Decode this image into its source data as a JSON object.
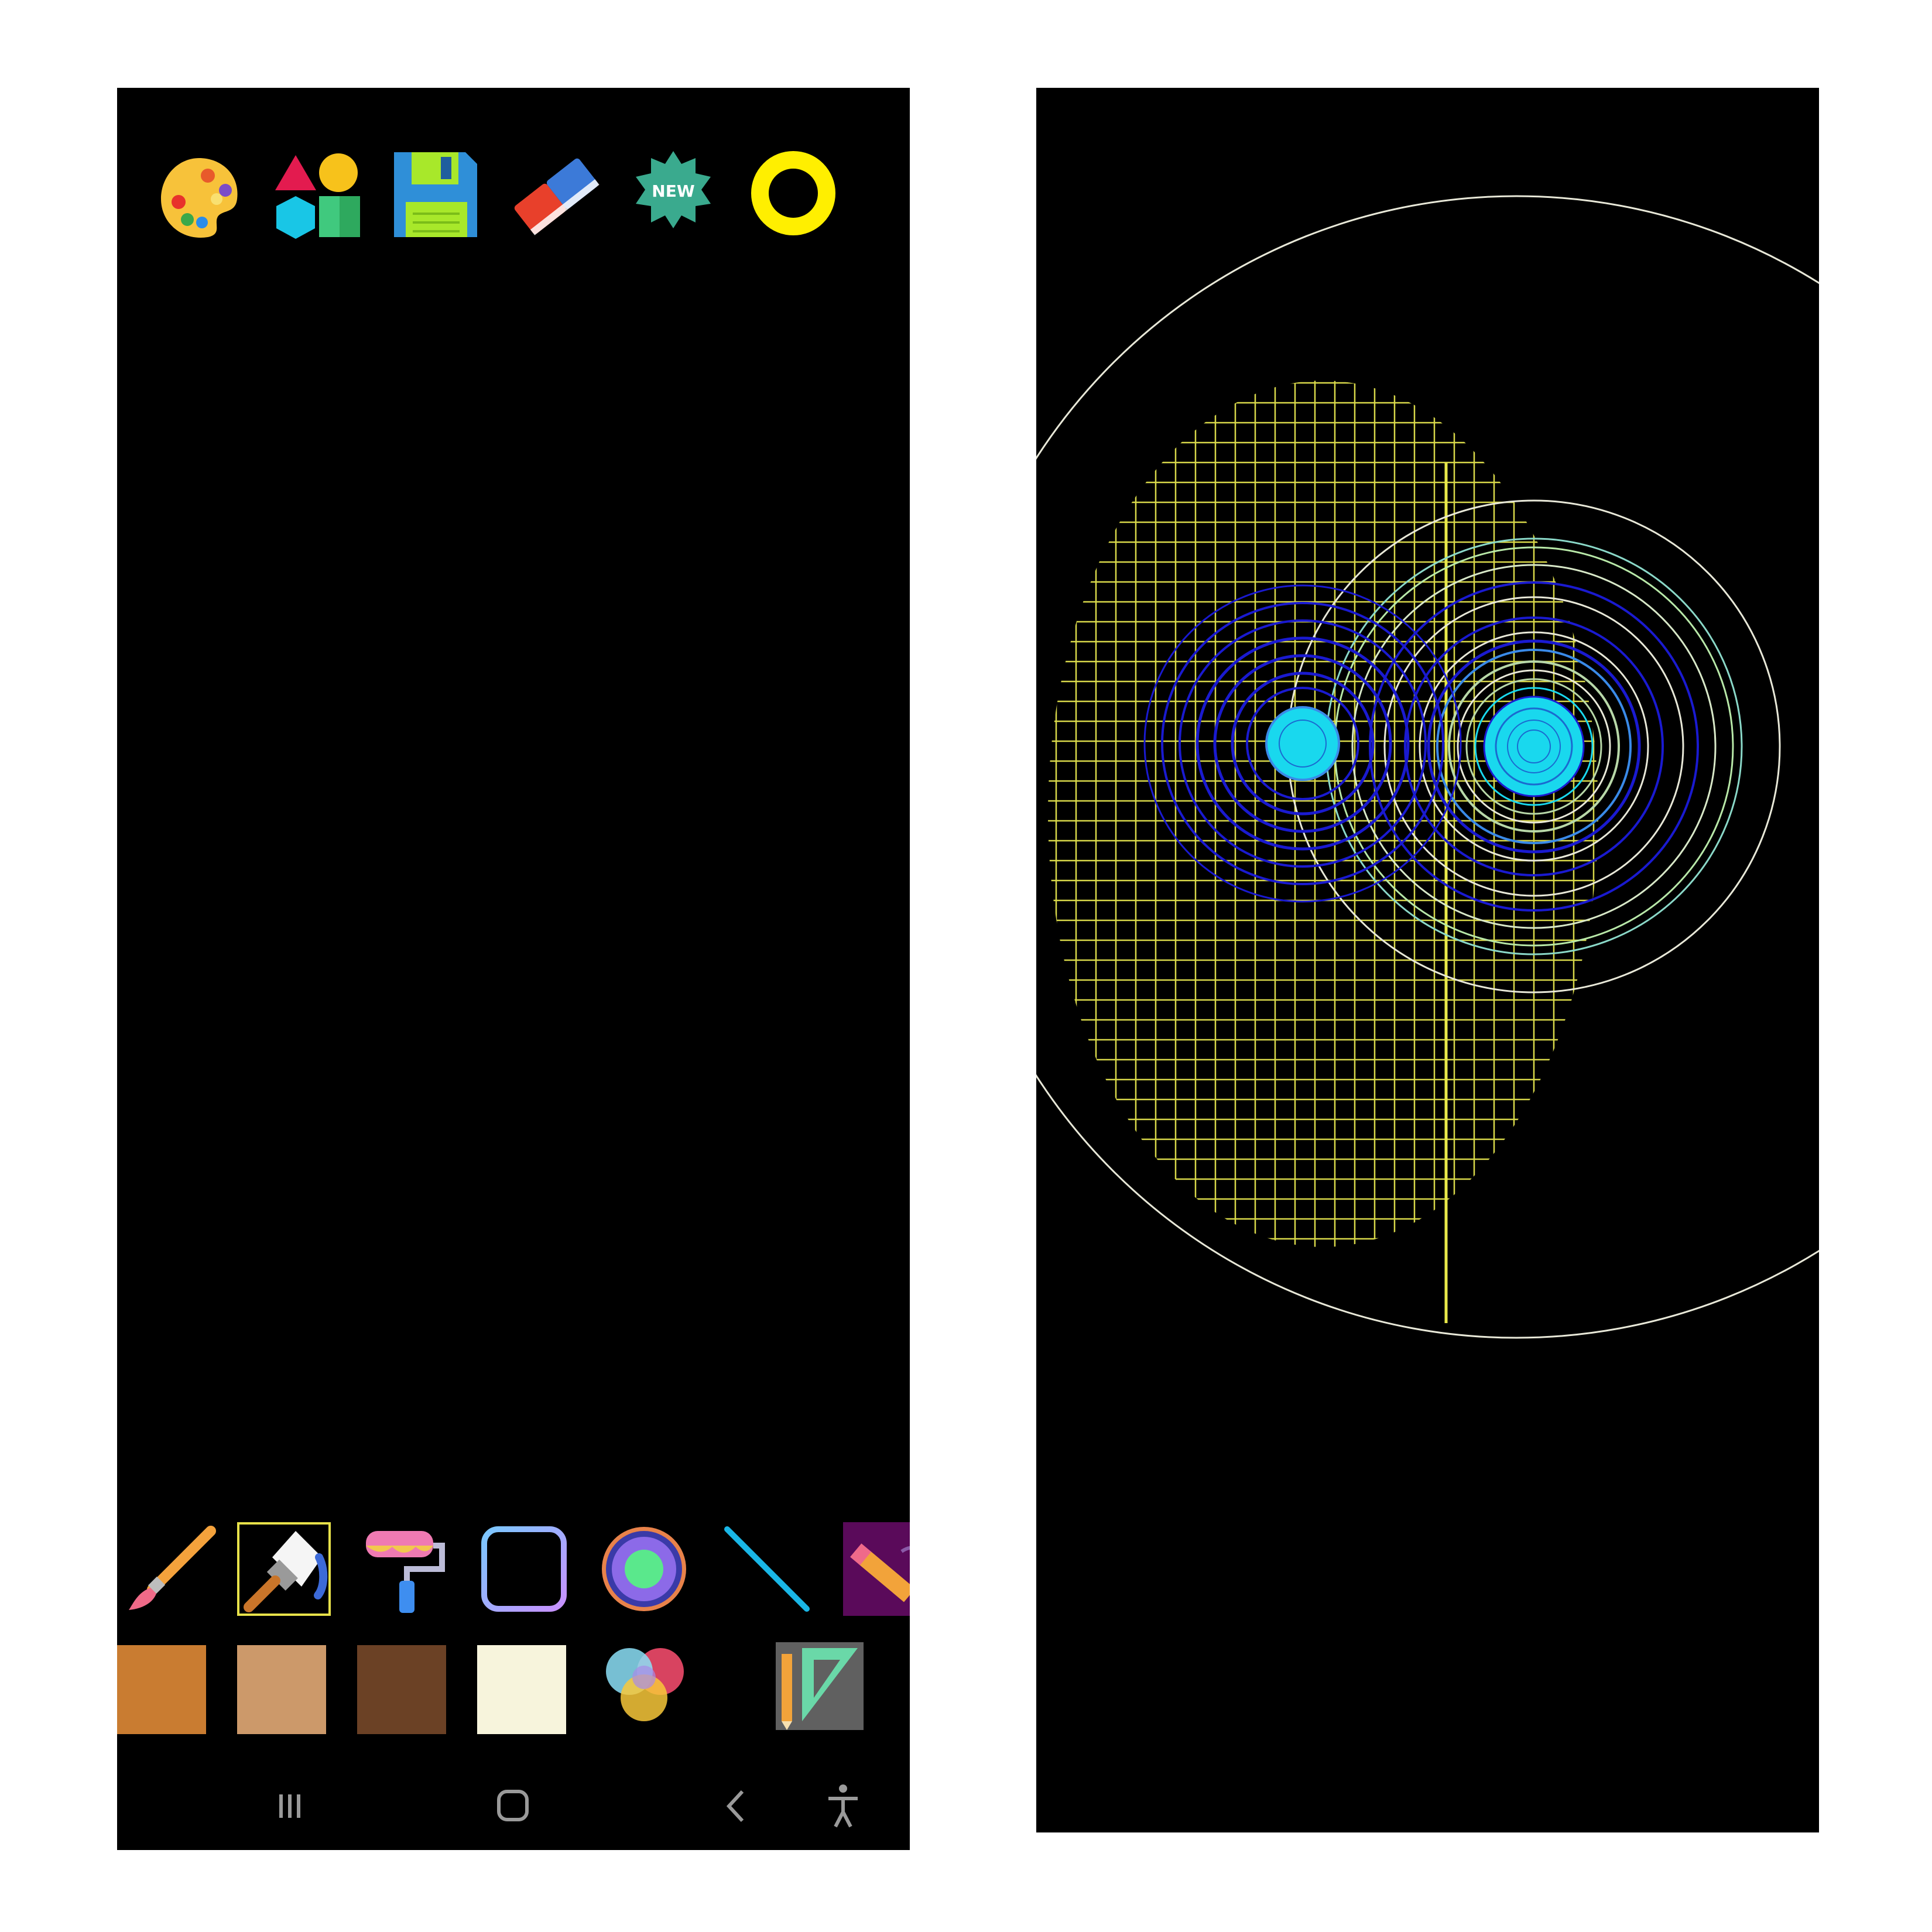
{
  "left_screen": {
    "top_toolbar": [
      {
        "name": "palette-icon"
      },
      {
        "name": "shapes-icon"
      },
      {
        "name": "save-floppy-icon"
      },
      {
        "name": "eraser-icon"
      },
      {
        "name": "new-badge-icon",
        "label": "NEW"
      },
      {
        "name": "brush-size-ring-icon",
        "color": "#ffef00"
      }
    ],
    "bottom_tools": [
      {
        "name": "paint-brush-icon"
      },
      {
        "name": "paint-bucket-brush-icon",
        "selected": true
      },
      {
        "name": "paint-roller-icon"
      },
      {
        "name": "rounded-square-icon"
      },
      {
        "name": "radial-gradient-icon"
      },
      {
        "name": "line-icon"
      },
      {
        "name": "pencil-icon"
      }
    ],
    "color_swatches": [
      "#c97c31",
      "#cc996a",
      "#6b4125",
      "#f7f4dc"
    ],
    "extra_tools": [
      {
        "name": "color-mixer-icon"
      },
      {
        "name": "ruler-pencil-icon"
      }
    ],
    "nav_bar": [
      {
        "name": "recent-apps-icon"
      },
      {
        "name": "home-icon"
      },
      {
        "name": "back-icon"
      },
      {
        "name": "accessibility-icon"
      }
    ]
  },
  "right_screen": {
    "canvas_colors": {
      "background": "#000000",
      "grid": "#d8d84a",
      "outer_circle": "#e8e8d8",
      "inner_rings_dark": "#1a1ad0",
      "inner_rings_light": "#b8d8a8",
      "center_fill": "#19d8ee"
    }
  }
}
